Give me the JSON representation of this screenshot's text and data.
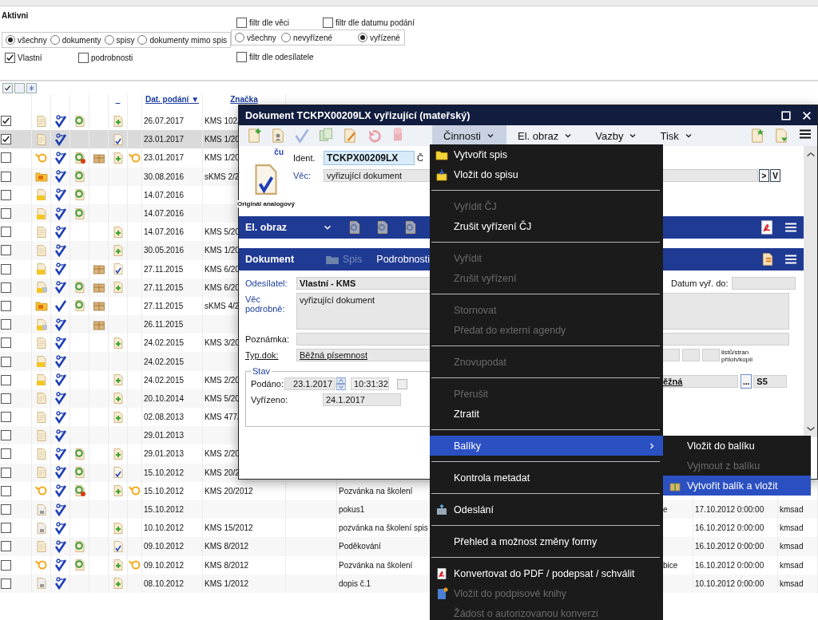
{
  "filters": {
    "title": "Aktivni",
    "scope": [
      {
        "label": "všechny",
        "selected": true
      },
      {
        "label": "dokumenty",
        "selected": false
      },
      {
        "label": "spisy",
        "selected": false
      },
      {
        "label": "dokumenty mimo spis",
        "selected": false
      }
    ],
    "status": [
      {
        "label": "všechny",
        "selected": false
      },
      {
        "label": "nevyřízené",
        "selected": false
      },
      {
        "label": "vyřízené",
        "selected": true
      }
    ],
    "options": [
      {
        "label": "Vlastní",
        "checked": true
      },
      {
        "label": "podrobnosti",
        "checked": false
      }
    ],
    "extra": [
      {
        "label": "filtr dle věci",
        "checked": false
      },
      {
        "label": "filtr dle datumu podání",
        "checked": false
      },
      {
        "label": "filtr dle odesílatele",
        "checked": false
      }
    ]
  },
  "table": {
    "columns": [
      "_",
      "Dat. podání ▼",
      "Značka"
    ],
    "rows": [
      {
        "checked": true,
        "selected": false,
        "icons": [
          {
            "kind": "doc"
          },
          {
            "kind": "key"
          },
          {
            "kind": "e"
          },
          {
            "kind": "none"
          },
          {
            "kind": "plus"
          },
          {
            "kind": "none"
          }
        ],
        "date": "26.07.2017",
        "ref": "KMS 102/"
      },
      {
        "checked": true,
        "selected": true,
        "icons": [
          {
            "kind": "doc"
          },
          {
            "kind": "key"
          },
          {
            "kind": "none"
          },
          {
            "kind": "none"
          },
          {
            "kind": "check-doc"
          },
          {
            "kind": "none"
          }
        ],
        "date": "23.01.2017",
        "ref": "KMS 1/20"
      },
      {
        "checked": false,
        "selected": false,
        "icons": [
          {
            "kind": "mail"
          },
          {
            "kind": "key"
          },
          {
            "kind": "e-badge"
          },
          {
            "kind": "package"
          },
          {
            "kind": "plus"
          },
          {
            "kind": "mail"
          }
        ],
        "date": "23.01.2017",
        "ref": "KMS 1/20"
      },
      {
        "checked": false,
        "selected": false,
        "icons": [
          {
            "kind": "folder-h"
          },
          {
            "kind": "key"
          },
          {
            "kind": "e"
          },
          {
            "kind": "none"
          },
          {
            "kind": "none"
          },
          {
            "kind": "none"
          }
        ],
        "date": "30.08.2016",
        "ref": "sKMS 2/2"
      },
      {
        "checked": false,
        "selected": false,
        "icons": [
          {
            "kind": "folder"
          },
          {
            "kind": "key"
          },
          {
            "kind": "e"
          },
          {
            "kind": "none"
          },
          {
            "kind": "none"
          },
          {
            "kind": "none"
          }
        ],
        "date": "14.07.2016"
      },
      {
        "checked": false,
        "selected": false,
        "icons": [
          {
            "kind": "folder"
          },
          {
            "kind": "key"
          },
          {
            "kind": "e"
          },
          {
            "kind": "none"
          },
          {
            "kind": "none"
          },
          {
            "kind": "none"
          }
        ],
        "date": "14.07.2016"
      },
      {
        "checked": false,
        "selected": false,
        "icons": [
          {
            "kind": "doc"
          },
          {
            "kind": "key"
          },
          {
            "kind": "none"
          },
          {
            "kind": "none"
          },
          {
            "kind": "plus"
          },
          {
            "kind": "none"
          }
        ],
        "date": "14.07.2016",
        "ref": "KMS 5/20"
      },
      {
        "checked": false,
        "selected": false,
        "icons": [
          {
            "kind": "doc"
          },
          {
            "kind": "key"
          },
          {
            "kind": "none"
          },
          {
            "kind": "none"
          },
          {
            "kind": "plus"
          },
          {
            "kind": "none"
          }
        ],
        "date": "30.05.2016",
        "ref": "KMS 1/20"
      },
      {
        "checked": false,
        "selected": false,
        "icons": [
          {
            "kind": "folder"
          },
          {
            "kind": "key"
          },
          {
            "kind": "none"
          },
          {
            "kind": "package"
          },
          {
            "kind": "check-doc"
          },
          {
            "kind": "none"
          }
        ],
        "date": "27.11.2015",
        "ref": "KMS 6/20"
      },
      {
        "checked": false,
        "selected": false,
        "icons": [
          {
            "kind": "folder-scan"
          },
          {
            "kind": "key"
          },
          {
            "kind": "e"
          },
          {
            "kind": "package"
          },
          {
            "kind": "plus"
          },
          {
            "kind": "none"
          }
        ],
        "date": "27.11.2015",
        "ref": "KMS 6/20"
      },
      {
        "checked": false,
        "selected": false,
        "icons": [
          {
            "kind": "folder-h"
          },
          {
            "kind": "check"
          },
          {
            "kind": "e"
          },
          {
            "kind": "package"
          },
          {
            "kind": "none"
          },
          {
            "kind": "none"
          }
        ],
        "date": "27.11.2015",
        "ref": "sKMS 4/2"
      },
      {
        "checked": false,
        "selected": false,
        "icons": [
          {
            "kind": "folder-scan"
          },
          {
            "kind": "key"
          },
          {
            "kind": "none"
          },
          {
            "kind": "package"
          },
          {
            "kind": "none"
          },
          {
            "kind": "none"
          }
        ],
        "date": "26.11.2015"
      },
      {
        "checked": false,
        "selected": false,
        "icons": [
          {
            "kind": "doc"
          },
          {
            "kind": "key"
          },
          {
            "kind": "none"
          },
          {
            "kind": "none"
          },
          {
            "kind": "plus"
          },
          {
            "kind": "none"
          }
        ],
        "date": "24.02.2015",
        "ref": "KMS 3/20"
      },
      {
        "checked": false,
        "selected": false,
        "icons": [
          {
            "kind": "folder"
          },
          {
            "kind": "key"
          },
          {
            "kind": "none"
          },
          {
            "kind": "none"
          },
          {
            "kind": "none"
          },
          {
            "kind": "none"
          }
        ],
        "date": "24.02.2015"
      },
      {
        "checked": false,
        "selected": false,
        "icons": [
          {
            "kind": "folder"
          },
          {
            "kind": "key"
          },
          {
            "kind": "none"
          },
          {
            "kind": "none"
          },
          {
            "kind": "plus"
          },
          {
            "kind": "none"
          }
        ],
        "date": "24.02.2015",
        "ref": "KMS 2/20"
      },
      {
        "checked": false,
        "selected": false,
        "icons": [
          {
            "kind": "doc"
          },
          {
            "kind": "key"
          },
          {
            "kind": "none"
          },
          {
            "kind": "none"
          },
          {
            "kind": "plus"
          },
          {
            "kind": "none"
          }
        ],
        "date": "20.10.2014",
        "ref": "KMS 5/20"
      },
      {
        "checked": false,
        "selected": false,
        "icons": [
          {
            "kind": "doc"
          },
          {
            "kind": "key"
          },
          {
            "kind": "none"
          },
          {
            "kind": "none"
          },
          {
            "kind": "plus"
          },
          {
            "kind": "none"
          }
        ],
        "date": "02.08.2013",
        "ref": "KMS 477/"
      },
      {
        "checked": false,
        "selected": false,
        "icons": [
          {
            "kind": "doc"
          },
          {
            "kind": "key"
          },
          {
            "kind": "none"
          },
          {
            "kind": "none"
          },
          {
            "kind": "none"
          },
          {
            "kind": "none"
          }
        ],
        "date": "29.01.2013"
      },
      {
        "checked": false,
        "selected": false,
        "icons": [
          {
            "kind": "doc"
          },
          {
            "kind": "key"
          },
          {
            "kind": "e"
          },
          {
            "kind": "none"
          },
          {
            "kind": "plus"
          },
          {
            "kind": "none"
          }
        ],
        "date": "29.01.2013",
        "ref": "KMS 2/20"
      },
      {
        "checked": false,
        "selected": false,
        "icons": [
          {
            "kind": "doc"
          },
          {
            "kind": "key"
          },
          {
            "kind": "e"
          },
          {
            "kind": "none"
          },
          {
            "kind": "check-doc"
          },
          {
            "kind": "none"
          }
        ],
        "date": "15.10.2012",
        "ref": "KMS 20/2"
      },
      {
        "checked": false,
        "selected": false,
        "icons": [
          {
            "kind": "mail"
          },
          {
            "kind": "key"
          },
          {
            "kind": "e-badge"
          },
          {
            "kind": "none"
          },
          {
            "kind": "plus"
          },
          {
            "kind": "mail"
          }
        ],
        "date": "15.10.2012",
        "ref": "KMS 20/2012",
        "subject": "Pozvánka na školení"
      },
      {
        "checked": false,
        "selected": false,
        "icons": [
          {
            "kind": "doc-lock"
          },
          {
            "kind": "key"
          },
          {
            "kind": "none"
          },
          {
            "kind": "none"
          },
          {
            "kind": "none"
          },
          {
            "kind": "none"
          }
        ],
        "date": "15.10.2012",
        "subject": "pokus1",
        "column_a": "e",
        "due": "17.10.2012 0:00:00",
        "user": "kmsad"
      },
      {
        "checked": false,
        "selected": false,
        "icons": [
          {
            "kind": "doc-lock"
          },
          {
            "kind": "key"
          },
          {
            "kind": "none"
          },
          {
            "kind": "none"
          },
          {
            "kind": "plus"
          },
          {
            "kind": "none"
          }
        ],
        "date": "10.10.2012",
        "ref": "KMS 15/2012",
        "subject": "pozvánka na školení spis",
        "due": "16.10.2012 0:00:00",
        "user": "kmsad"
      },
      {
        "checked": false,
        "selected": false,
        "icons": [
          {
            "kind": "doc"
          },
          {
            "kind": "key"
          },
          {
            "kind": "e"
          },
          {
            "kind": "none"
          },
          {
            "kind": "check-doc"
          },
          {
            "kind": "none"
          }
        ],
        "date": "09.10.2012",
        "ref": "KMS 8/2012",
        "subject": "Poděkování",
        "due": "16.10.2012 0:00:00",
        "user": "kmsad"
      },
      {
        "checked": false,
        "selected": false,
        "icons": [
          {
            "kind": "mail"
          },
          {
            "kind": "key"
          },
          {
            "kind": "e"
          },
          {
            "kind": "none"
          },
          {
            "kind": "plus"
          },
          {
            "kind": "mail"
          }
        ],
        "date": "09.10.2012",
        "ref": "KMS 8/2012",
        "subject": "Pozvánka na školení",
        "column_a": "bice",
        "due": "16.10.2012 0:00:00",
        "user": "kmsad"
      },
      {
        "checked": false,
        "selected": false,
        "icons": [
          {
            "kind": "doc-lock"
          },
          {
            "kind": "key"
          },
          {
            "kind": "none"
          },
          {
            "kind": "none"
          },
          {
            "kind": "plus"
          },
          {
            "kind": "none"
          }
        ],
        "date": "08.10.2012",
        "ref": "KMS 1/2012",
        "subject": "dopis č.1",
        "due": "10.10.2012 0:00:00",
        "user": "kmsad"
      }
    ]
  },
  "dialog": {
    "title": "Dokument TCKPX00209LX vyřizující (mateřský)",
    "menus": [
      {
        "label": "Činnosti",
        "selected": true
      },
      {
        "label": "El. obraz",
        "selected": false
      },
      {
        "label": "Vazby",
        "selected": false
      },
      {
        "label": "Tisk",
        "selected": false
      }
    ],
    "header": {
      "link": "ču",
      "ident_label": "Ident.",
      "ident": "TCKPX00209LX",
      "ref_label": "Č",
      "subject_label": "Věc:",
      "subject": "vyřizující dokument",
      "buttons": [
        ">",
        "V"
      ],
      "icon_caption": "Originál analogový"
    },
    "image_band": {
      "title": "El. obraz"
    },
    "doc_band": {
      "title": "Dokument",
      "tabs": [
        {
          "label": "Spis",
          "disabled": true
        },
        {
          "label": "Podrobnosti",
          "disabled": false
        }
      ]
    },
    "form": {
      "sender_label": "Odesílatel:",
      "sender": "Vlastní - KMS",
      "due_label": "Datum vyř. do:",
      "detail_label": "Věc podrobně:",
      "detail": "vyřizující dokument",
      "note_label": "Poznámka:",
      "type_label": "Typ.dok:",
      "type": "Běžná písemnost",
      "counts_label": [
        "listů/stran",
        "příloh/kopií"
      ],
      "status": {
        "legend": "Stav",
        "filed_label": "Podáno:",
        "filed_date": "23.1.2017",
        "filed_time": "10:31:32",
        "done_label": "Vyřízeno:",
        "done": "24.1.2017",
        "flag": {
          "checked": false
        }
      },
      "mode": "ěžná",
      "mode_button": "...",
      "code": "S5"
    }
  },
  "menu": {
    "items": [
      {
        "kind": "folder",
        "label": "Vytvořit spis",
        "disabled": false,
        "selected": false
      },
      {
        "kind": "folder-add",
        "label": "Vložit do spisu",
        "disabled": false,
        "selected": false
      },
      {
        "kind": "separator"
      },
      {
        "kind": "item",
        "label": "Vyřídit ČJ",
        "disabled": true,
        "selected": false
      },
      {
        "kind": "item",
        "label": "Zrušit vyřízení ČJ",
        "disabled": false,
        "selected": false
      },
      {
        "kind": "separator"
      },
      {
        "kind": "item",
        "label": "Vyřídit",
        "disabled": true,
        "selected": false
      },
      {
        "kind": "item",
        "label": "Zrušit vyřízení",
        "disabled": true,
        "selected": false
      },
      {
        "kind": "separator"
      },
      {
        "kind": "item",
        "label": "Stornovat",
        "disabled": true,
        "selected": false
      },
      {
        "kind": "item",
        "label": "Předat do externí agendy",
        "disabled": true,
        "selected": false
      },
      {
        "kind": "separator"
      },
      {
        "kind": "item",
        "label": "Znovupodat",
        "disabled": true,
        "selected": false
      },
      {
        "kind": "separator"
      },
      {
        "kind": "item",
        "label": "Přerušit",
        "disabled": true,
        "selected": false
      },
      {
        "kind": "item",
        "label": "Ztratit",
        "disabled": false,
        "selected": false
      },
      {
        "kind": "separator"
      },
      {
        "kind": "submenu",
        "label": "Balíky",
        "disabled": false,
        "selected": true
      },
      {
        "kind": "separator"
      },
      {
        "kind": "item",
        "label": "Kontrola metadat",
        "disabled": false,
        "selected": false
      },
      {
        "kind": "separator"
      },
      {
        "kind": "send",
        "label": "Odeslání",
        "disabled": false,
        "selected": false
      },
      {
        "kind": "separator"
      },
      {
        "kind": "item",
        "label": "Přehled a možnost změny formy",
        "disabled": false,
        "selected": false
      },
      {
        "kind": "separator"
      },
      {
        "kind": "pdf",
        "label": "Konvertovat do PDF / podepsat / schválit",
        "disabled": false,
        "selected": false
      },
      {
        "kind": "sign-book",
        "label": "Vložit do podpisové knihy",
        "disabled": true,
        "selected": false
      },
      {
        "kind": "item",
        "label": "Žádost o autorizovanou konverzi",
        "disabled": true,
        "selected": false
      }
    ]
  },
  "submenu": {
    "items": [
      {
        "kind": "item",
        "label": "Vložit do balíku",
        "disabled": false,
        "selected": false
      },
      {
        "kind": "item",
        "label": "Vyjmout z balíku",
        "disabled": true,
        "selected": false
      },
      {
        "kind": "package",
        "label": "Vytvořit balík a vložit",
        "disabled": false,
        "selected": true
      }
    ]
  }
}
